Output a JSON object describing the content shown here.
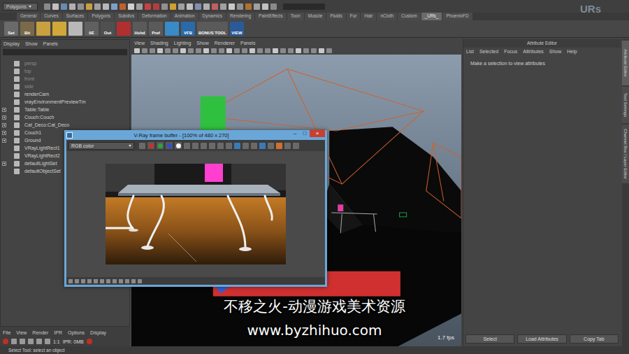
{
  "menu_mode": {
    "label": "Polygons"
  },
  "logo": {
    "label": "URs"
  },
  "shelf_tabs": [
    {
      "label": "General",
      "selected": false
    },
    {
      "label": "Curves",
      "selected": false
    },
    {
      "label": "Surfaces",
      "selected": false
    },
    {
      "label": "Polygons",
      "selected": false
    },
    {
      "label": "Subdivs",
      "selected": false
    },
    {
      "label": "Deformation",
      "selected": false
    },
    {
      "label": "Animation",
      "selected": false
    },
    {
      "label": "Dynamics",
      "selected": false
    },
    {
      "label": "Rendering",
      "selected": false
    },
    {
      "label": "PaintEffects",
      "selected": false
    },
    {
      "label": "Toon",
      "selected": false
    },
    {
      "label": "Muscle",
      "selected": false
    },
    {
      "label": "Fluids",
      "selected": false
    },
    {
      "label": "Fur",
      "selected": false
    },
    {
      "label": "Hair",
      "selected": false
    },
    {
      "label": "nCloth",
      "selected": false
    },
    {
      "label": "Custom",
      "selected": false
    },
    {
      "label": "_URs_",
      "selected": true
    },
    {
      "label": "PhoenixFD",
      "selected": false
    }
  ],
  "shelf_buttons": [
    {
      "label": "Set",
      "color": "#6a6a6a"
    },
    {
      "label": "Bit",
      "color": "#7a6a4a"
    },
    {
      "color": "#c8a040"
    },
    {
      "color": "#d0a838"
    },
    {
      "color": "#b8b8b8"
    },
    {
      "label": "0E",
      "color": "#606060"
    },
    {
      "label": "Out",
      "color": "#505050"
    },
    {
      "color": "#b03030"
    },
    {
      "label": "Hshd",
      "color": "#5a5a5a"
    },
    {
      "label": "Pref",
      "color": "#5a5a5a"
    },
    {
      "color": "#3a8ac8"
    },
    {
      "label": "VFB",
      "color": "#2a6aa8"
    },
    {
      "label": "BONUS TOOL",
      "color": "#5a5a5a"
    },
    {
      "label": "VIEW",
      "color": "#2a5a98"
    }
  ],
  "outliner": {
    "menu": [
      "Display",
      "Show",
      "Panels"
    ],
    "items": [
      {
        "label": "persp",
        "dimmed": true,
        "expandable": false
      },
      {
        "label": "top",
        "dimmed": true,
        "expandable": false
      },
      {
        "label": "front",
        "dimmed": true,
        "expandable": false
      },
      {
        "label": "side",
        "dimmed": true,
        "expandable": false
      },
      {
        "label": "renderCam",
        "dimmed": false,
        "expandable": false
      },
      {
        "label": "vrayEnvironmentPreviewTm",
        "dimmed": false,
        "expandable": false
      },
      {
        "label": "Table:Table",
        "dimmed": false,
        "expandable": true
      },
      {
        "label": "Couch:Couch",
        "dimmed": false,
        "expandable": true
      },
      {
        "label": "Cat_Deco:Cat_Deco",
        "dimmed": false,
        "expandable": true
      },
      {
        "label": "Couch1",
        "dimmed": false,
        "expandable": true
      },
      {
        "label": "Ground",
        "dimmed": false,
        "expandable": true
      },
      {
        "label": "VRayLightRect1",
        "dimmed": false,
        "expandable": false
      },
      {
        "label": "VRayLightRect2",
        "dimmed": false,
        "expandable": false
      },
      {
        "label": "defaultLightSet",
        "dimmed": false,
        "expandable": true
      },
      {
        "label": "defaultObjectSet",
        "dimmed": false,
        "expandable": false
      }
    ]
  },
  "render_view": {
    "menu": [
      "File",
      "View",
      "Render",
      "IPR",
      "Options",
      "Display"
    ],
    "readouts": [
      "1:1",
      "IPR: 0MB"
    ]
  },
  "viewport": {
    "menu": [
      "View",
      "Shading",
      "Lighting",
      "Show",
      "Renderer",
      "Panels"
    ],
    "fps": "1.7 fps"
  },
  "vfb": {
    "title": "V-Ray frame buffer - [100% of 480 x 270]",
    "controls": [
      "–",
      "□",
      "×"
    ],
    "channel": "RGB color",
    "channel_buttons": [
      {
        "color": "#c83030"
      },
      {
        "color": "#30a040"
      },
      {
        "color": "#3050c8"
      },
      {
        "color": "#f4f4f4"
      }
    ]
  },
  "attribute_editor": {
    "title": "Attribute Editor",
    "menu": [
      "List",
      "Selected",
      "Focus",
      "Attributes",
      "Show",
      "Help"
    ],
    "message": "Make a selection to view attributes",
    "buttons": [
      "Select",
      "Load Attributes",
      "Copy Tab"
    ]
  },
  "side_tabs": [
    {
      "label": "Attribute Editor",
      "selected": true
    },
    {
      "label": "Tool Settings",
      "selected": false
    },
    {
      "label": "Channel Box / Layer Editor",
      "selected": false
    }
  ],
  "status_bar": {
    "text": "Select Tool: select an object"
  },
  "watermark": {
    "title": "不移之火-动漫游戏美术资源",
    "url": "www.byzhihuo.com"
  }
}
